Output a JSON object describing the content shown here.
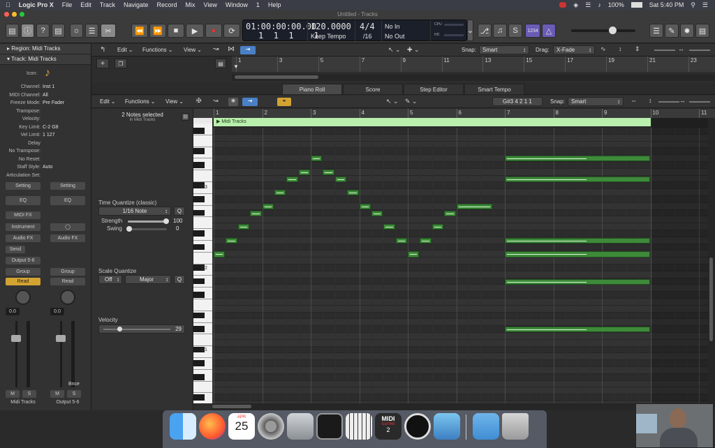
{
  "menubar": {
    "apple": "",
    "app": "Logic Pro X",
    "items": [
      "File",
      "Edit",
      "Track",
      "Navigate",
      "Record",
      "Mix",
      "View",
      "Window",
      "1",
      "Help"
    ],
    "battery": "100%",
    "clock": "Sat 5:40 PM"
  },
  "window": {
    "title": "Untitled - Tracks"
  },
  "lcd": {
    "position": "01:00:00:00.00",
    "bars": "1  1  1    1",
    "tempo": "120.0000",
    "tempo_label": "Keep Tempo",
    "sig_top": "4/4",
    "sig_bottom": "/16",
    "in": "No In",
    "out": "No Out",
    "cpu": "CPU",
    "hd": "HD"
  },
  "toolbar": {
    "counter": "1234"
  },
  "inspector": {
    "region": "Region: Midi Tracks",
    "track": "Track:  Midi Tracks",
    "icon_label": "Icon:",
    "rows": [
      {
        "k": "Channel:",
        "v": "Inst 1"
      },
      {
        "k": "MIDI Channel:",
        "v": "All"
      },
      {
        "k": "Freeze Mode:",
        "v": "Pre Fader"
      },
      {
        "k": "Transpose:",
        "v": ""
      },
      {
        "k": "Velocity:",
        "v": ""
      },
      {
        "k": "Key Limit:",
        "v": "C-2  G8"
      },
      {
        "k": "Vel Limit:",
        "v": "1  127"
      },
      {
        "k": "Delay",
        "v": ""
      },
      {
        "k": "No Transpose:",
        "v": ""
      },
      {
        "k": "No Reset:",
        "v": ""
      },
      {
        "k": "Staff Style:",
        "v": "Auto"
      },
      {
        "k": "Articulation Set:",
        "v": ""
      }
    ]
  },
  "strips": {
    "setting": "Setting",
    "eq": "EQ",
    "midi_fx": "MIDI FX",
    "instrument": "Instrument",
    "audio_fx": "Audio FX",
    "send": "Send",
    "output": "Output 5-6",
    "group": "Group",
    "read": "Read",
    "vol_left": "0.0",
    "vol_right": "0.0",
    "bnce": "Bnce",
    "m": "M",
    "s": "S",
    "name_left": "Midi Tracks",
    "name_right": "Output 5-6"
  },
  "tracks_bar": {
    "edit": "Edit",
    "functions": "Functions",
    "view": "View",
    "snap_label": "Snap:",
    "snap": "Smart",
    "drag_label": "Drag:",
    "drag": "X-Fade",
    "ruler": [
      "1",
      "3",
      "5",
      "7",
      "9",
      "11",
      "13",
      "15",
      "17",
      "19",
      "21",
      "23"
    ]
  },
  "tabs": [
    "Piano Roll",
    "Score",
    "Step Editor",
    "Smart Tempo"
  ],
  "pianoroll": {
    "edit": "Edit",
    "functions": "Functions",
    "view": "View",
    "position": "G#3  4 2 1 1",
    "snap_label": "Snap:",
    "snap": "Smart",
    "selection": "2 Notes selected",
    "selection_sub": "in Midi Tracks",
    "region_name": "Midi Tracks",
    "ruler": [
      "1",
      "2",
      "3",
      "4",
      "5",
      "6",
      "7",
      "8",
      "9",
      "10",
      "11"
    ],
    "key_labels": [
      "C3",
      "C2",
      "C1"
    ],
    "time_quantize_title": "Time Quantize (classic)",
    "time_quantize_value": "1/16 Note",
    "q": "Q",
    "strength_label": "Strength",
    "strength_value": "100",
    "swing_label": "Swing",
    "swing_value": "0",
    "scale_quantize_title": "Scale Quantize",
    "scale_off": "Off",
    "scale_major": "Major",
    "velocity_title": "Velocity",
    "velocity_value": "29"
  },
  "notes": [
    {
      "start": 1.0,
      "len": 0.25,
      "row": 18
    },
    {
      "start": 1.25,
      "len": 0.25,
      "row": 16
    },
    {
      "start": 1.5,
      "len": 0.25,
      "row": 14
    },
    {
      "start": 1.75,
      "len": 0.25,
      "row": 12
    },
    {
      "start": 2.0,
      "len": 0.25,
      "row": 11
    },
    {
      "start": 2.25,
      "len": 0.25,
      "row": 9
    },
    {
      "start": 2.5,
      "len": 0.25,
      "row": 7
    },
    {
      "start": 2.75,
      "len": 0.25,
      "row": 6
    },
    {
      "start": 3.0,
      "len": 0.25,
      "row": 4
    },
    {
      "start": 3.25,
      "len": 0.25,
      "row": 6
    },
    {
      "start": 3.5,
      "len": 0.25,
      "row": 7
    },
    {
      "start": 3.75,
      "len": 0.25,
      "row": 9
    },
    {
      "start": 4.0,
      "len": 0.25,
      "row": 11
    },
    {
      "start": 4.25,
      "len": 0.25,
      "row": 12
    },
    {
      "start": 4.5,
      "len": 0.25,
      "row": 14
    },
    {
      "start": 4.75,
      "len": 0.25,
      "row": 16
    },
    {
      "start": 5.0,
      "len": 0.25,
      "row": 18
    },
    {
      "start": 5.25,
      "len": 0.25,
      "row": 16
    },
    {
      "start": 5.5,
      "len": 0.25,
      "row": 14
    },
    {
      "start": 5.75,
      "len": 0.25,
      "row": 12
    },
    {
      "start": 6.0,
      "len": 0.75,
      "row": 11
    },
    {
      "start": 7.0,
      "len": 3.0,
      "row": 4
    },
    {
      "start": 7.0,
      "len": 3.0,
      "row": 7
    },
    {
      "start": 7.0,
      "len": 3.0,
      "row": 16
    },
    {
      "start": 7.0,
      "len": 3.0,
      "row": 18
    },
    {
      "start": 7.0,
      "len": 3.0,
      "row": 22
    },
    {
      "start": 7.0,
      "len": 3.0,
      "row": 29
    }
  ],
  "dock": [
    "finder-icon",
    "firefox-icon",
    "calendar-icon",
    "system-prefs-icon",
    "disk-utility-icon",
    "activity-monitor-icon",
    "piano-icon",
    "midi-guitar-icon",
    "obs-icon",
    "preview-icon",
    "folder-icon",
    "trash-icon"
  ],
  "dock_texts": {
    "cal_month": "APR",
    "cal_day": "25",
    "midi": "MIDI",
    "guitar": "GUITAR",
    "two": "2"
  }
}
